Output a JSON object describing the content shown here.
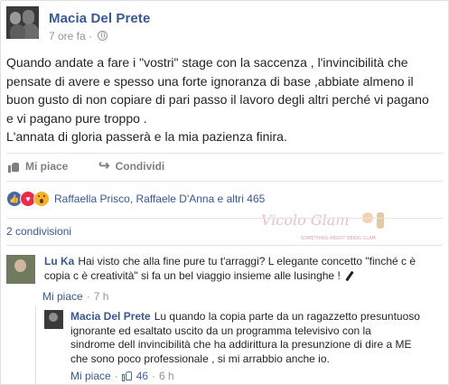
{
  "post": {
    "author": "Macia Del Prete",
    "time": "7 ore fa",
    "time_sep": "·",
    "text_lines": [
      "Quando andate a fare i \"vostri\" stage con la saccenza , l'invincibilità che",
      "pensate di avere e spesso una forte ignoranza di base ,abbiate almeno il",
      "buon gusto di non copiare di pari passo il lavoro degli altri perché vi pagano",
      "e vi pagano pure troppo .",
      "L'annata di gloria passerà e la mia pazienza finira."
    ]
  },
  "actions": {
    "like_label": "Mi piace",
    "share_label": "Condividi"
  },
  "reactions": {
    "names": "Raffaella Prisco, Raffaele D'Anna e altri 465",
    "icons": [
      "like-icon",
      "love-icon",
      "wow-icon"
    ]
  },
  "shares": {
    "label": "2 condivisioni"
  },
  "watermark": {
    "script_text": "Vicolo Glam",
    "small_text": "SOMETHING ABOUT BEING GLAM"
  },
  "comments": [
    {
      "author": "Lu Ka",
      "text_line1": "Hai visto che alla fine pure tu t'arraggi? L elegante concetto \"finché c è",
      "text_line2": "copia c è creatività\" si fa un bel viaggio insieme alle lusinghe !",
      "like_label": "Mi piace",
      "sep": "·",
      "time": "7 h"
    },
    {
      "author": "Macia Del Prete",
      "text_line1": "Lu quando la copia parte da un ragazzetto presuntuoso",
      "text_line2": "ignorante ed esaltato uscito da un programma televisivo con la",
      "text_line3": "sindrome dell invincibilità che ha addirittura la presunzione di dire a ME",
      "text_line4": "che sono poco professionale , si mi arrabbio anche io.",
      "like_label": "Mi piace",
      "sep": "·",
      "likes": "46",
      "sep2": "·",
      "time": "6 h"
    }
  ],
  "colors": {
    "link": "#365899",
    "meta": "#90949c",
    "text": "#1d2129",
    "like_blue": "#4267b2",
    "love_red": "#f0284a",
    "wow_yellow": "#f7b125"
  }
}
